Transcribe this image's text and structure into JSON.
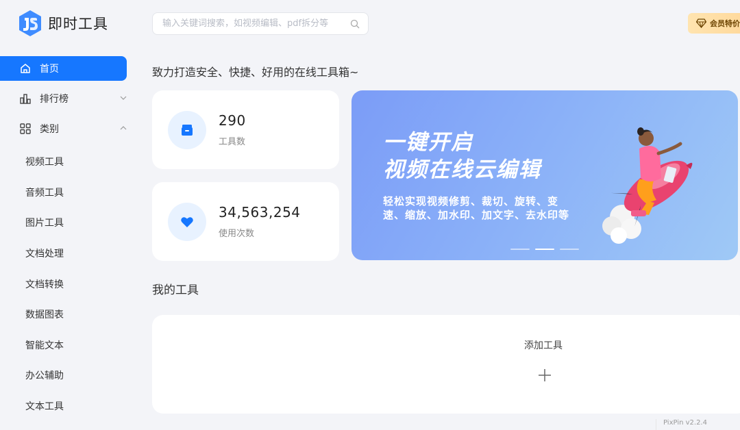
{
  "app": {
    "title": "即时工具"
  },
  "search": {
    "placeholder": "输入关键词搜索，如视频编辑、pdf拆分等"
  },
  "vip": {
    "label": "会员特价"
  },
  "nav": {
    "home": "首页",
    "ranking": "排行榜",
    "category": "类别",
    "sub_items": [
      "视频工具",
      "音频工具",
      "图片工具",
      "文档处理",
      "文档转换",
      "数据图表",
      "智能文本",
      "办公辅助",
      "文本工具"
    ]
  },
  "main": {
    "slogan": "致力打造安全、快捷、好用的在线工具箱~",
    "stats": [
      {
        "value": "290",
        "label": "工具数",
        "icon": "box-icon"
      },
      {
        "value": "34,563,254",
        "label": "使用次数",
        "icon": "heart-icon"
      }
    ],
    "banner": {
      "title_line1": "一键开启",
      "title_line2": "视频在线云编辑",
      "sub_line1": "轻松实现视频修剪、裁切、旋转、变",
      "sub_line2": "速、缩放、加水印、加文字、去水印等",
      "active_slide": 2,
      "slide_count": 3
    },
    "my_tools": {
      "title": "我的工具",
      "add_label": "添加工具"
    }
  },
  "watermark": "PixPin v2.2.4",
  "colors": {
    "accent": "#1677ff",
    "background": "#f3f4f8",
    "banner": "#8ab0f8",
    "vip": "#ffd89a"
  }
}
